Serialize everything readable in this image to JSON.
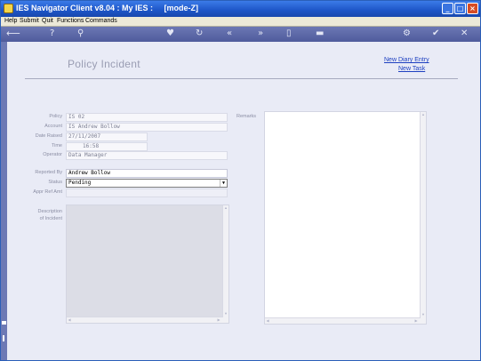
{
  "window": {
    "title": "IES Navigator Client v8.04 : My IES :     [mode-Z]"
  },
  "menu": [
    "Help",
    "Submit",
    "Quit",
    "Functions",
    "Commands"
  ],
  "toolbar_icons": [
    "back-arrow-icon",
    "help-icon",
    "search-icon",
    "heart-icon",
    "refresh-icon",
    "rewind-icon",
    "fast-forward-icon",
    "document-icon",
    "list-icon",
    "settings-icon",
    "check-icon",
    "close-icon"
  ],
  "page": {
    "title": "Policy Incident",
    "links": {
      "new_diary_entry": "New Diary Entry",
      "new_task": "New Task"
    }
  },
  "form": {
    "policy": {
      "label": "Policy",
      "value": "IS 02"
    },
    "account": {
      "label": "Account",
      "value": "IS Andrew Bollow"
    },
    "date_raised": {
      "label": "Date Raised",
      "value": "27/11/2007"
    },
    "time": {
      "label": "Time",
      "value": "16:58"
    },
    "operator": {
      "label": "Operator",
      "value": "Data Manager"
    },
    "reported_by": {
      "label": "Reported By",
      "value": "Andrew Bollow"
    },
    "status": {
      "label": "Status",
      "value": "Pending"
    },
    "appr_ref_amt": {
      "label": "Appr Ref Amt",
      "value": ""
    },
    "description": {
      "label_line1": "Description",
      "label_line2": "of Incident",
      "value": ""
    },
    "remarks": {
      "label": "Remarks",
      "value": ""
    }
  },
  "colors": {
    "titlebar": "#1d55c7",
    "toolbar": "#5a66a6",
    "background": "#e9ebf6",
    "link": "#1d3fc0"
  }
}
